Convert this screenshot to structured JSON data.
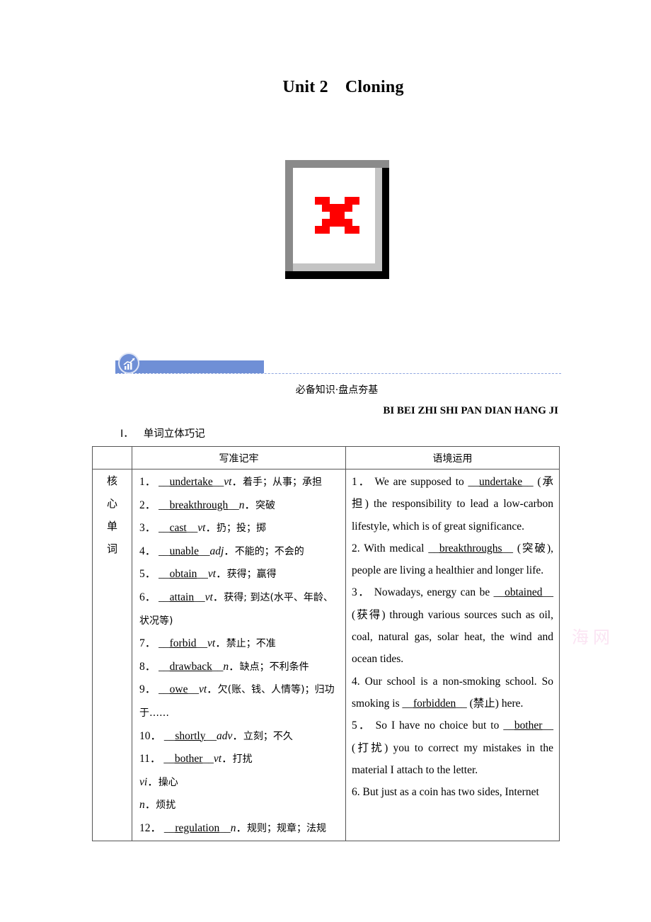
{
  "title": {
    "unit": "Unit 2",
    "topic": "Cloning"
  },
  "image_placeholder": {
    "icon": "broken-image-icon",
    "accent": "#ff0000"
  },
  "section": {
    "icon": "chart-growth-icon",
    "banner_color": "#6f8fd6",
    "heading_cn": "必备知识·盘点夯基",
    "heading_pinyin": "BI BEI ZHI SHI PAN DIAN HANG JI"
  },
  "sub_heading": {
    "number": "Ⅰ．",
    "text": "单词立体巧记"
  },
  "table": {
    "headers": [
      "",
      "写准记牢",
      "语境运用"
    ],
    "side_label": [
      "核",
      "心",
      "单",
      "词"
    ],
    "vocab": [
      {
        "num": "1．",
        "word": "undertake",
        "pos": "vt",
        "meaning": "着手；从事；承担"
      },
      {
        "num": "2．",
        "word": "breakthrough",
        "pos": "n",
        "meaning": "突破"
      },
      {
        "num": "3．",
        "word": "cast",
        "pos": "vt",
        "meaning": "扔；投；掷"
      },
      {
        "num": "4．",
        "word": "unable",
        "pos": "adj",
        "meaning": "不能的；不会的"
      },
      {
        "num": "5．",
        "word": "obtain",
        "pos": "vt",
        "meaning": "获得；赢得"
      },
      {
        "num": "6．",
        "word": "attain",
        "pos": "vt",
        "meaning": "获得; 到达(水平、年龄、状况等)"
      },
      {
        "num": "7．",
        "word": "forbid",
        "pos": "vt",
        "meaning": "禁止；不准"
      },
      {
        "num": "8．",
        "word": "drawback",
        "pos": "n",
        "meaning": "缺点；不利条件"
      },
      {
        "num": "9．",
        "word": "owe",
        "pos": "vt",
        "meaning": "欠(账、钱、人情等)；归功于……"
      },
      {
        "num": "10．",
        "word": "shortly",
        "pos": "adv",
        "meaning": "立刻；不久"
      },
      {
        "num": "11．",
        "word": "bother",
        "pos": "vt",
        "meaning": "打扰",
        "extra": [
          {
            "pos": "vi",
            "meaning": "操心"
          },
          {
            "pos": "n",
            "meaning": "烦扰"
          }
        ]
      },
      {
        "num": "12．",
        "word": "regulation",
        "pos": "n",
        "meaning": "规则；规章；法规"
      }
    ],
    "sentences": [
      {
        "num": "1．",
        "before": " We are supposed to ",
        "answer": "undertake",
        "hint": "(承担)",
        "after": " the responsibility to  lead a low-carbon lifestyle, which is of great significance."
      },
      {
        "num": "2.",
        "before": " With medical ",
        "answer": "breakthroughs",
        "hint": "(突破)",
        "after": ", people are living a  healthier and longer life."
      },
      {
        "num": "3．",
        "before": " Nowadays, energy can be ",
        "answer": "obtained",
        "hint": "(获得)",
        "after": " through various sources such as oil, coal, natural gas, solar heat, the  wind and ocean tides."
      },
      {
        "num": "4.",
        "before": " Our school is a non-smoking school.  So smoking is ",
        "answer": "forbidden",
        "hint": "(禁止)",
        "after": " here."
      },
      {
        "num": "5．",
        "before": " So I have no choice but to ",
        "answer": "bother",
        "hint": "(打扰)",
        "after": " you to correct my mistakes in the material I attach to the letter."
      },
      {
        "num": " 6.",
        "before": " But just as a coin has two sides, Internet",
        "answer": "",
        "hint": "",
        "after": ""
      }
    ]
  },
  "watermark": "海网"
}
